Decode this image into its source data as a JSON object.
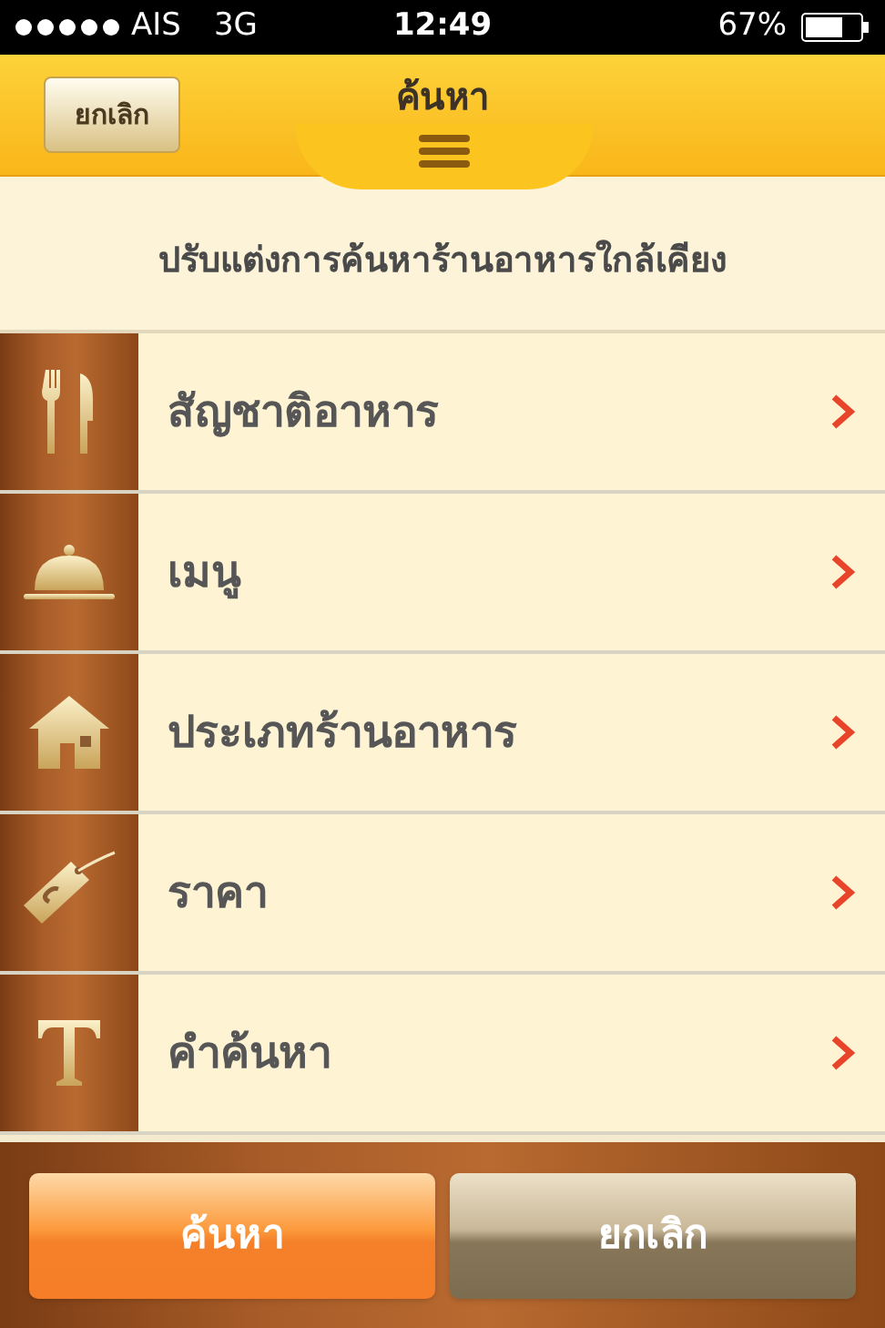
{
  "status_bar": {
    "carrier": "AIS",
    "network": "3G",
    "time": "12:49",
    "battery": "67%"
  },
  "header": {
    "cancel_button": "ยกเลิก",
    "title": "ค้นหา"
  },
  "subtitle": "ปรับแต่งการค้นหาร้านอาหารใกล้เคียง",
  "items": [
    {
      "label": "สัญชาติอาหาร",
      "kind": "cutlery"
    },
    {
      "label": "เมนู",
      "kind": "cloche"
    },
    {
      "label": "ประเภทร้านอาหาร",
      "kind": "house"
    },
    {
      "label": "ราคา",
      "kind": "tag"
    },
    {
      "label": "คำค้นหา",
      "kind": "text"
    }
  ],
  "footer": {
    "search_button": "ค้นหา",
    "cancel_button": "ยกเลิก"
  }
}
